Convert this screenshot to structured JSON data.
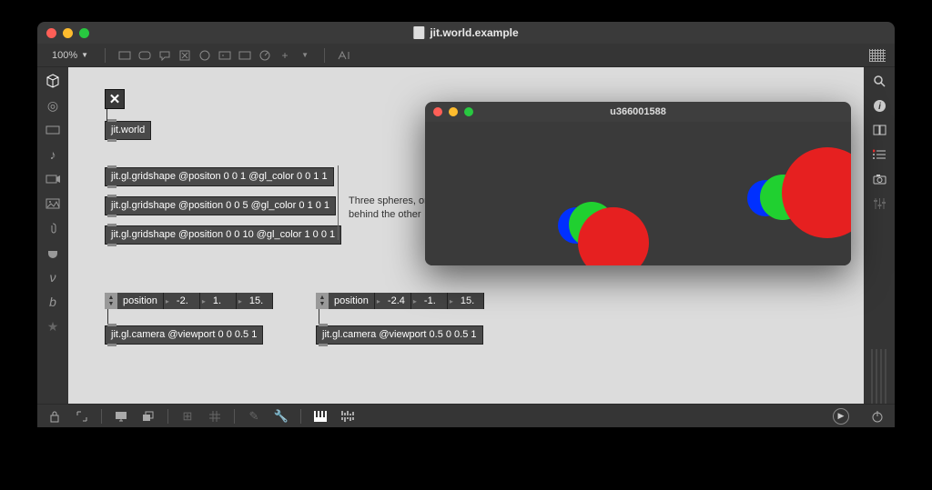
{
  "window_title": "jit.world.example",
  "zoom": "100%",
  "toggle": "✕",
  "jitworld": "jit.world",
  "shapes": [
    "jit.gl.gridshape @positon 0 0 1 @gl_color 0 0 1 1",
    "jit.gl.gridshape @position 0 0 5 @gl_color 0 1 0 1",
    "jit.gl.gridshape @position 0 0 10 @gl_color 1 0 0 1"
  ],
  "comment": "Three spheres, one behind the other",
  "attr": {
    "label": "position",
    "a": [
      "-2.",
      "1.",
      "15."
    ],
    "b": [
      "-2.4",
      "-1.",
      "15."
    ]
  },
  "cameras": [
    "jit.gl.camera @viewport 0 0 0.5 1",
    "jit.gl.camera @viewport 0.5 0 0.5 1"
  ],
  "render_title": "u366001588"
}
